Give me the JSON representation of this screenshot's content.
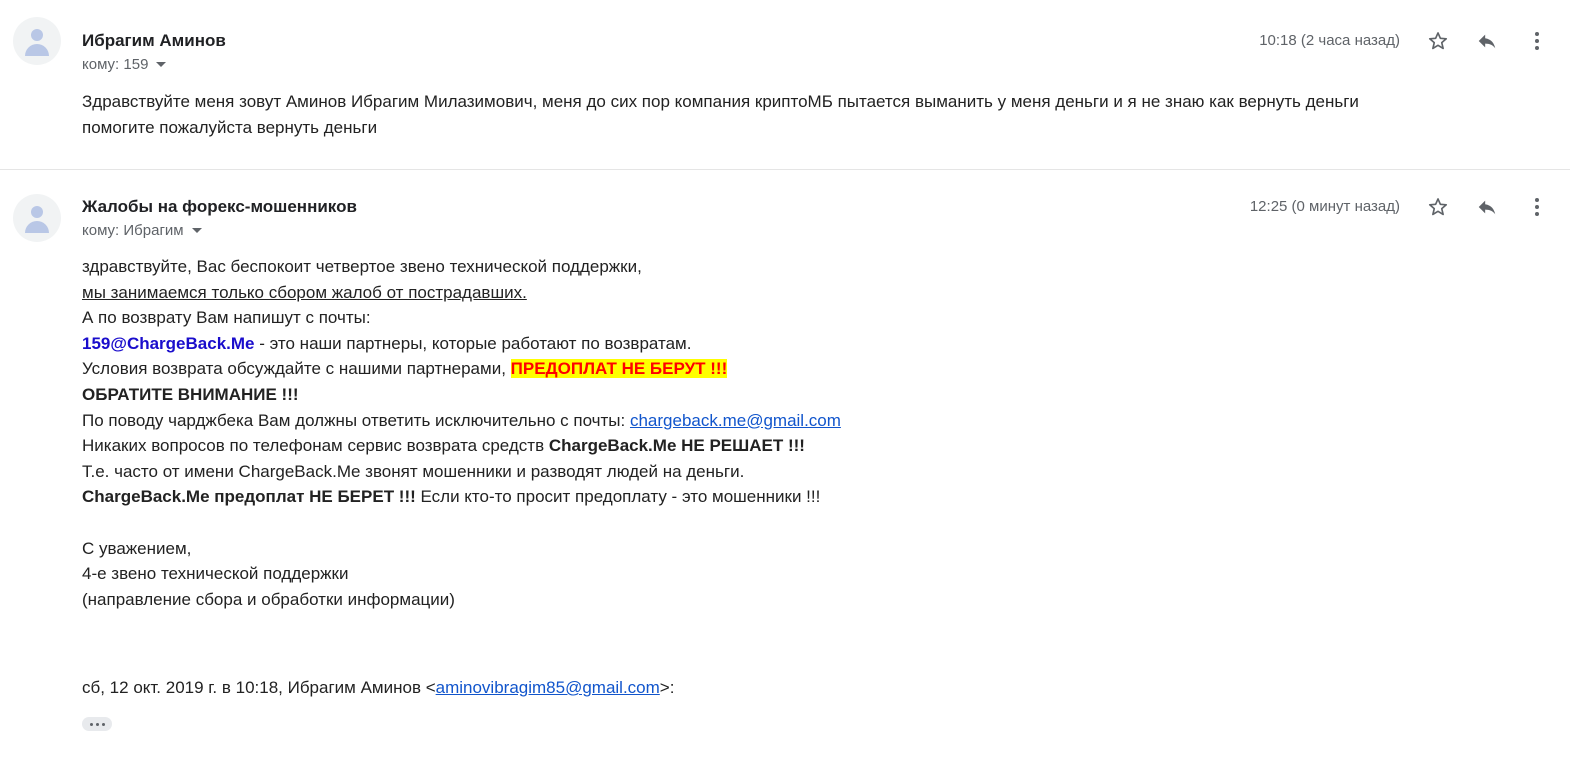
{
  "messages": [
    {
      "sender": "Ибрагим Аминов",
      "recipient": "кому: 159",
      "time": "10:18 (2 часа назад)",
      "body": [
        "Здравствуйте меня зовут Аминов Ибрагим Милазимович, меня до сих пор компания криптоМБ пытается выманить у меня деньги и я не знаю как вернуть деньги",
        "помогите пожалуйста вернуть деньги"
      ]
    },
    {
      "sender": "Жалобы на форекс-мошенников",
      "recipient": "кому: Ибрагим",
      "time": "12:25 (0 минут назад)",
      "body": {
        "l1": "здравствуйте, Вас беспокоит четвертое звено технической поддержки,",
        "l2": "мы занимаемся только сбором жалоб от пострадавших.",
        "l3": "А по возврату Вам напишут с почты:",
        "l4_email": "159@ChargeBack.Me",
        "l4_rest": " - это наши партнеры, которые работают по возвратам.",
        "l5_text": "Условия возврата обсуждайте с нашими партнерами, ",
        "l5_alert": "ПРЕДОПЛАТ НЕ БЕРУТ !!!",
        "l6": "ОБРАТИТЕ ВНИМАНИЕ !!!",
        "l7_text": "По поводу чарджбека Вам должны ответить исключительно с почты: ",
        "l7_link": "chargeback.me@gmail.com",
        "l8_text": "Никаких вопросов по телефонам сервис возврата средств ",
        "l8_bold": "ChargeBack.Me НЕ РЕШАЕТ !!!",
        "l9": "Т.е. часто от имени ChargeBack.Me звонят мошенники и разводят людей на деньги.",
        "l10_bold": "ChargeBack.Me предоплат НЕ БЕРЕТ !!!",
        "l10_rest": " Если кто-то просит предоплату - это мошенники !!!",
        "s1": "С уважением,",
        "s2": "4-е звено технической поддержки",
        "s3": "(направление сбора и обработки информации)"
      },
      "quote": {
        "prefix": "сб, 12 окт. 2019 г. в 10:18, Ибрагим Аминов <",
        "email": "aminovibragim85@gmail.com",
        "suffix": ">:"
      }
    }
  ],
  "icons": {
    "avatar": "person-avatar-icon",
    "star": "star-icon",
    "reply": "reply-icon",
    "more": "more-vertical-icon",
    "ellipsis": "show-trimmed-content-icon"
  },
  "colors": {
    "link": "#1155cc",
    "email_highlight": "#1a0dcc",
    "alert_background": "#ffff00",
    "alert_text": "#ff0000"
  }
}
